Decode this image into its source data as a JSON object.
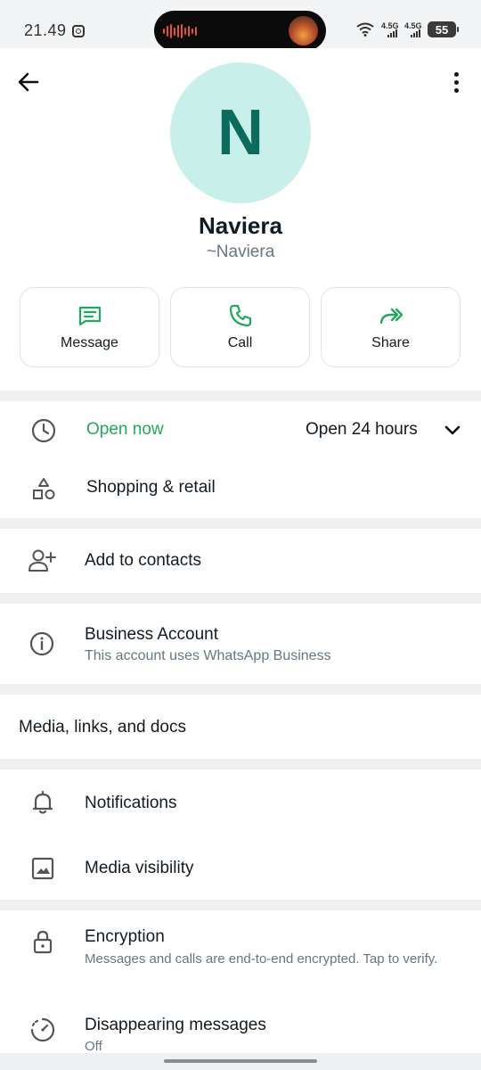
{
  "status_bar": {
    "time": "21.49",
    "network_1": "4.5G",
    "network_2": "4.5G",
    "battery": "55"
  },
  "header": {
    "avatar_letter": "N",
    "name": "Naviera",
    "subname": "~Naviera"
  },
  "actions": [
    {
      "label": "Message",
      "icon": "message-icon"
    },
    {
      "label": "Call",
      "icon": "phone-icon"
    },
    {
      "label": "Share",
      "icon": "share-icon"
    }
  ],
  "hours": {
    "status": "Open now",
    "schedule": "Open 24 hours",
    "category": "Shopping & retail"
  },
  "contacts": {
    "label": "Add to contacts"
  },
  "business": {
    "title": "Business Account",
    "subtitle": "This account uses WhatsApp Business"
  },
  "media": {
    "label": "Media, links, and docs"
  },
  "settings": {
    "notifications": "Notifications",
    "media_visibility": "Media visibility"
  },
  "encryption": {
    "title": "Encryption",
    "subtitle": "Messages and calls are end-to-end encrypted. Tap to verify.",
    "disappearing_title": "Disappearing messages",
    "disappearing_value": "Off"
  },
  "colors": {
    "accent_green": "#1faa5b",
    "avatar_bg": "#c8efe9",
    "avatar_fg": "#0b6b5c"
  }
}
